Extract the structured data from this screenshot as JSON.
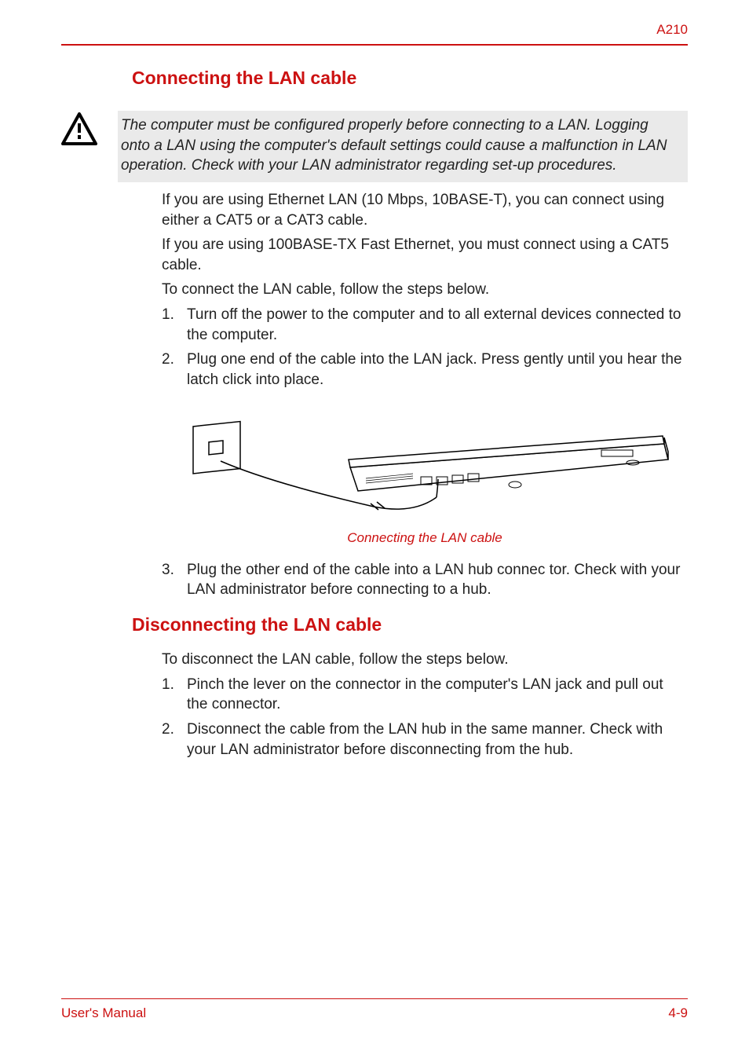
{
  "header": {
    "model": "A210"
  },
  "section1": {
    "heading": "Connecting the LAN cable",
    "warning": "The computer must be configured properly before connecting to a LAN. Logging onto a LAN using the computer's default settings could cause a malfunction in LAN operation. Check with your LAN administrator regarding set-up procedures.",
    "para1": "If you are using Ethernet LAN (10 Mbps, 10BASE-T), you can connect using either a CAT5 or a CAT3 cable.",
    "para2": "If you are using 100BASE-TX Fast Ethernet, you must connect using a CAT5 cable.",
    "para3": "To connect the LAN cable, follow the steps below.",
    "steps_a": [
      {
        "num": "1.",
        "text": "Turn off the power to the computer and to all external devices connected to the computer."
      },
      {
        "num": "2.",
        "text": "Plug one end of the cable into the LAN jack. Press gently until you hear the latch click into place."
      }
    ],
    "figure_caption": "Connecting the LAN cable",
    "steps_b": [
      {
        "num": "3.",
        "text": "Plug the other end of the cable into a LAN hub connec tor. Check with your LAN administrator before connecting to a hub."
      }
    ]
  },
  "section2": {
    "heading": "Disconnecting the LAN cable",
    "para1": "To disconnect the LAN cable, follow the steps below.",
    "steps": [
      {
        "num": "1.",
        "text": "Pinch the lever on the connector in the computer's LAN jack and pull out the connector."
      },
      {
        "num": "2.",
        "text": "Disconnect the cable from the LAN hub in the same manner. Check with your LAN administrator before disconnecting from the hub."
      }
    ]
  },
  "footer": {
    "left": "User's Manual",
    "right": "4-9"
  }
}
